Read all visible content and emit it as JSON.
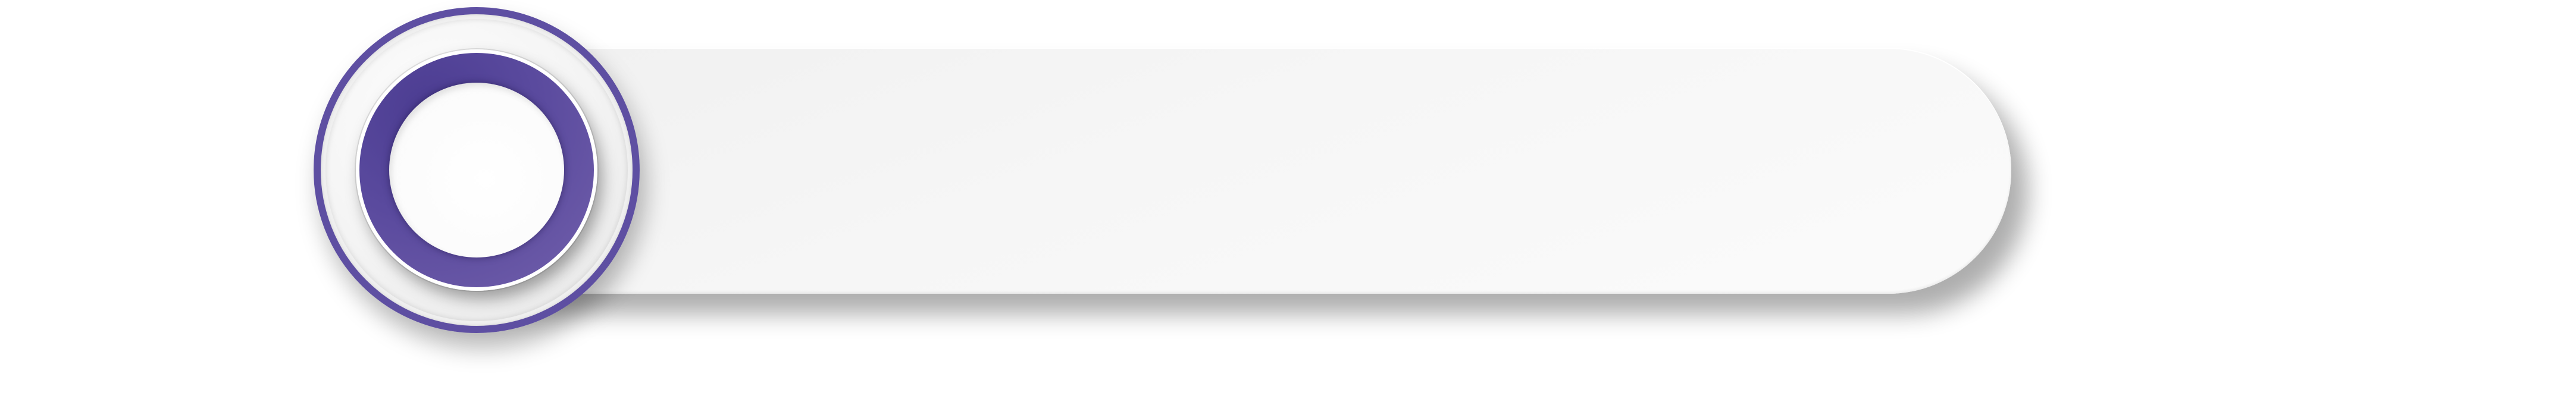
{
  "graphic": {
    "accent_color": "#5e4fa2",
    "disc_color": "#5a4a9e",
    "bar_color": "#f4f4f4",
    "background_color": "#ffffff"
  }
}
